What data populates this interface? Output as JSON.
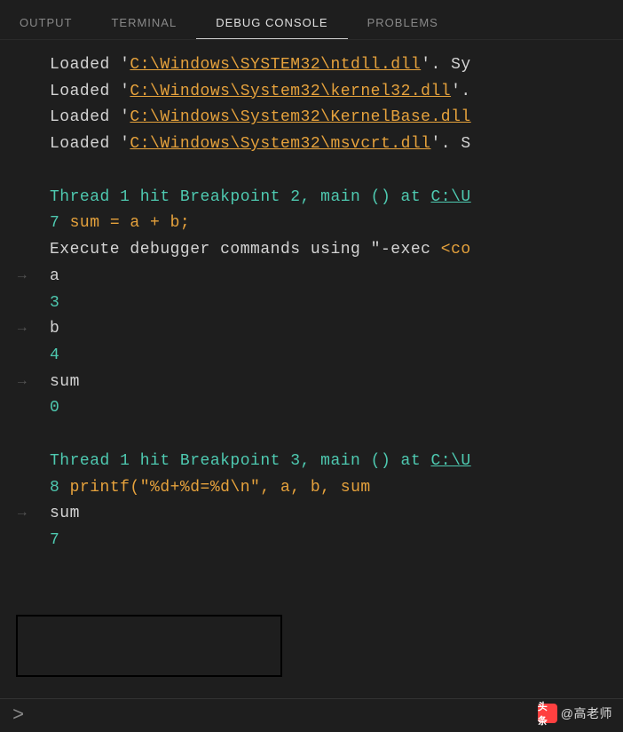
{
  "tabs": {
    "output": "OUTPUT",
    "terminal": "TERMINAL",
    "debug_console": "DEBUG CONSOLE",
    "problems": "PROBLEMS"
  },
  "console": {
    "loaded_prefix": "Loaded '",
    "loaded_suffix_sy": "'. Sy",
    "loaded_suffix_dot": "'. ",
    "loaded_suffix_s": "'. S",
    "dll_ntdll": "C:\\Windows\\SYSTEM32\\ntdll.dll",
    "dll_kernel32": "C:\\Windows\\System32\\kernel32.dll",
    "dll_kernelbase": "C:\\Windows\\System32\\KernelBase.dll",
    "dll_msvcrt": "C:\\Windows\\System32\\msvcrt.dll",
    "bp2_text": "Thread 1 hit Breakpoint 2, main () at ",
    "bp_path": "C:\\U",
    "bp2_linenum": "7",
    "bp2_code": "           sum = a + b;",
    "exec_hint_pre": "Execute debugger commands using \"-exec ",
    "exec_hint_cmd": "<co",
    "var_a": "a",
    "val_a": "3",
    "var_b": "b",
    "val_b": "4",
    "var_sum": "sum",
    "val_sum": "0",
    "bp3_text": "Thread 1 hit Breakpoint 3, main () at ",
    "bp3_linenum": "8",
    "bp3_code": "           printf(\"%d+%d=%d\\n\", a, b, sum",
    "var_sum2": "sum",
    "val_sum2": "7"
  },
  "input": {
    "prompt": ">",
    "value": ""
  },
  "watermark": {
    "icon": "头条",
    "text": "@高老师"
  }
}
